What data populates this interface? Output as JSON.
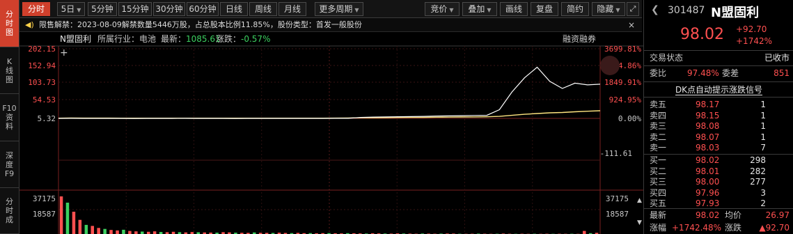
{
  "sidetabs": [
    {
      "label": [
        "分",
        "时",
        "图"
      ],
      "active": true
    },
    {
      "label": [
        "K",
        "线",
        "图"
      ],
      "active": false
    },
    {
      "label": [
        "F10",
        "资",
        "料"
      ],
      "active": false
    },
    {
      "label": [
        "深",
        "度",
        "F9"
      ],
      "active": false
    },
    {
      "label": [
        "分",
        "时",
        "成"
      ],
      "active": false
    }
  ],
  "toolbar": {
    "periods": [
      "分时",
      "5日",
      "5分钟",
      "15分钟",
      "30分钟",
      "60分钟",
      "日线",
      "周线",
      "月线",
      "更多周期"
    ],
    "tools": [
      "竞价",
      "叠加",
      "画线",
      "复盘",
      "简约",
      "隐藏"
    ]
  },
  "notice": {
    "text": "限售解禁：2023-08-09解禁数量5446万股，占总股本比例11.85%，股份类型：首发一般股份",
    "close": "×"
  },
  "info": {
    "name": "N盟固利",
    "industry": "所属行业：电池",
    "last_label": "最新：",
    "last_value": "1085.61",
    "change_label": "涨跌：",
    "change_value": "-0.57%",
    "margin_trading": "融资融券"
  },
  "chart_data": {
    "type": "line",
    "price_axis_left": [
      "202.15",
      "152.94",
      "103.73",
      "54.53",
      "5.32"
    ],
    "price_axis_right": [
      "3699.81%",
      "2774.86%",
      "1849.91%",
      "924.95%",
      "0.00%"
    ],
    "index_axis_right": [
      "-111.61"
    ],
    "volume_axis_left": [
      "37175",
      "18587"
    ],
    "volume_axis_right": [
      "37175",
      "18587"
    ],
    "ylim": [
      5.32,
      202.15
    ],
    "price_line": [
      5.3,
      5.5,
      5.4,
      5.3,
      5.4,
      5.3,
      5.2,
      5.3,
      5.4,
      5.3,
      5.5,
      5.3,
      5.4,
      5.3,
      5.2,
      5.4,
      5.3,
      5.3,
      5.4,
      5.3,
      5.3,
      5.4,
      5.5,
      5.6,
      8.0,
      9.0,
      9.5,
      10.0,
      10.5,
      11.0,
      12.0,
      12.5,
      13.0,
      13.5,
      14.0,
      30.0,
      80.0,
      120.0,
      150.0,
      110.0,
      90.0,
      105.0,
      100.0,
      102.0
    ],
    "avg_line": [
      6.0,
      6.3,
      6.2,
      6.1,
      6.1,
      6.0,
      6.0,
      6.0,
      6.0,
      6.0,
      6.0,
      6.0,
      6.0,
      6.0,
      6.0,
      6.0,
      6.0,
      6.0,
      6.0,
      6.0,
      6.0,
      6.0,
      6.2,
      6.5,
      7.0,
      7.3,
      7.5,
      7.8,
      8.0,
      8.3,
      8.6,
      8.9,
      9.2,
      9.5,
      9.8,
      11.0,
      14.0,
      17.0,
      19.0,
      21.0,
      22.0,
      24.0,
      25.5,
      26.97
    ],
    "volume": [
      37175,
      31000,
      22000,
      14000,
      9000,
      8000,
      6000,
      5000,
      4000,
      3500,
      4200,
      3000,
      2600,
      2400,
      2200,
      2600,
      2000,
      1800,
      2200,
      1800,
      1600,
      1900,
      1700,
      1500,
      1400,
      1300,
      1800,
      1600,
      1300,
      1200,
      1100,
      1500,
      1200,
      1100,
      1000,
      1300,
      1000,
      900,
      1100,
      800,
      900,
      700,
      800,
      900,
      700,
      600,
      800,
      700,
      600,
      500,
      700,
      600,
      500,
      400,
      600,
      500,
      400,
      300,
      500,
      400,
      300,
      400,
      500,
      400,
      300,
      200,
      300,
      400,
      300,
      200,
      300,
      400,
      300,
      200,
      300,
      200,
      300,
      200,
      300,
      200,
      300,
      200,
      300,
      200,
      3000,
      800,
      1200
    ]
  },
  "right": {
    "code": "301487",
    "name": "N盟固利",
    "price": "98.02",
    "change": "+92.70",
    "change_pct": "+1742%",
    "status_label": "交易状态",
    "status_value": "已收市",
    "weibi_label": "委比",
    "weibi_value": "97.48%",
    "weicha_label": "委差",
    "weicha_value": "851",
    "dk_signal": "DK点自动提示涨跌信号",
    "asks": [
      {
        "label": "卖五",
        "price": "98.17",
        "vol": "1"
      },
      {
        "label": "卖四",
        "price": "98.15",
        "vol": "1"
      },
      {
        "label": "卖三",
        "price": "98.08",
        "vol": "1"
      },
      {
        "label": "卖二",
        "price": "98.07",
        "vol": "1"
      },
      {
        "label": "卖一",
        "price": "98.03",
        "vol": "7"
      }
    ],
    "bids": [
      {
        "label": "买一",
        "price": "98.02",
        "vol": "298"
      },
      {
        "label": "买二",
        "price": "98.01",
        "vol": "282"
      },
      {
        "label": "买三",
        "price": "98.00",
        "vol": "277"
      },
      {
        "label": "买四",
        "price": "97.96",
        "vol": "3"
      },
      {
        "label": "买五",
        "price": "97.93",
        "vol": "2"
      }
    ],
    "latest_label": "最新",
    "latest_value": "98.02",
    "avg_label": "均价",
    "avg_value": "26.97",
    "pct_label": "涨幅",
    "pct_value": "+1742.48%",
    "chg_label": "涨跌",
    "chg_value": "▲92.70"
  },
  "colors": {
    "accent": "#d0402c",
    "up": "#ff5050",
    "down": "#3cd060",
    "price_line": "#ffffff",
    "avg_line": "#ffe680"
  }
}
